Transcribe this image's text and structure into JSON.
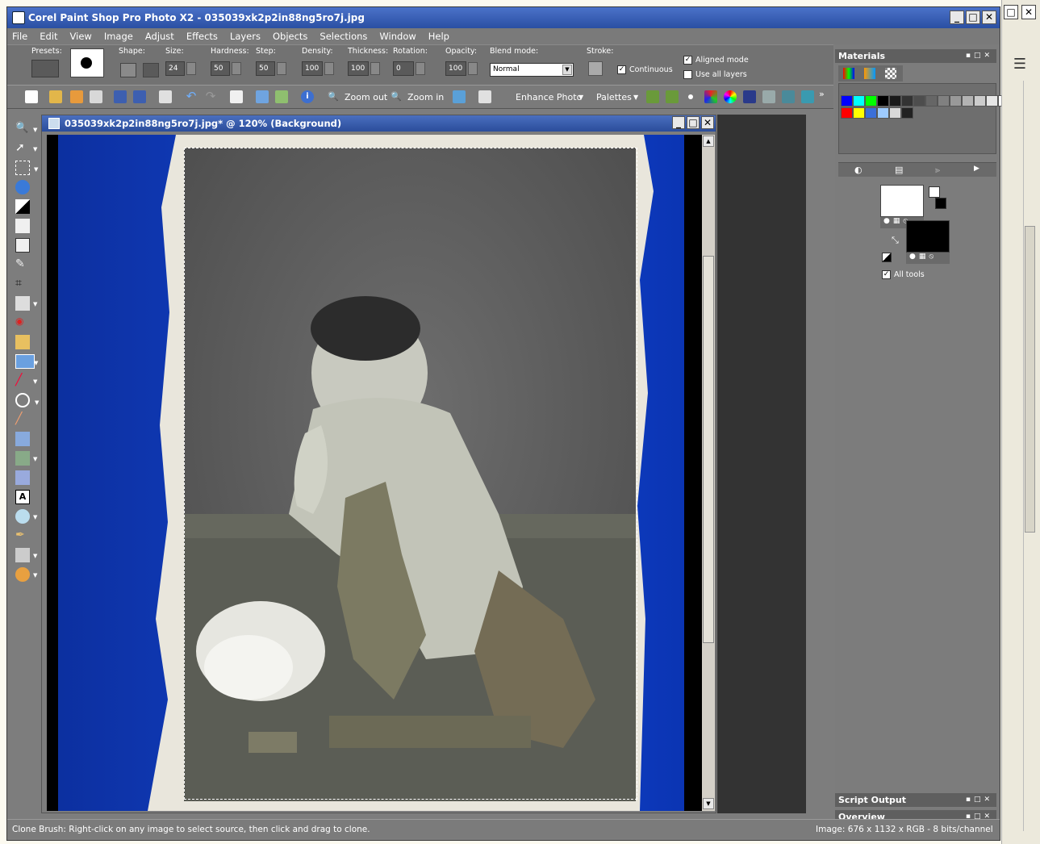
{
  "app": {
    "title": "Corel Paint Shop Pro Photo X2 - 035039xk2p2in88ng5ro7j.jpg"
  },
  "menu": [
    "File",
    "Edit",
    "View",
    "Image",
    "Adjust",
    "Effects",
    "Layers",
    "Objects",
    "Selections",
    "Window",
    "Help"
  ],
  "tool_options": {
    "presets_label": "Presets:",
    "shape_label": "Shape:",
    "size_label": "Size:",
    "size_value": "24",
    "hardness_label": "Hardness:",
    "hardness_value": "50",
    "step_label": "Step:",
    "step_value": "50",
    "density_label": "Density:",
    "density_value": "100",
    "thickness_label": "Thickness:",
    "thickness_value": "100",
    "rotation_label": "Rotation:",
    "rotation_value": "0",
    "opacity_label": "Opacity:",
    "opacity_value": "100",
    "blend_label": "Blend mode:",
    "blend_value": "Normal",
    "stroke_label": "Stroke:",
    "continuous_label": "Continuous",
    "continuous_checked": true,
    "aligned_label": "Aligned mode",
    "aligned_checked": true,
    "use_all_layers_label": "Use all layers",
    "use_all_layers_checked": false
  },
  "toolbar": {
    "zoom_out": "Zoom out",
    "zoom_in": "Zoom in",
    "enhance_photo": "Enhance Photo",
    "palettes": "Palettes"
  },
  "document": {
    "title": "035039xk2p2in88ng5ro7j.jpg* @ 120% (Background)"
  },
  "panels": {
    "materials": "Materials",
    "all_tools": "All tools",
    "all_tools_checked": true,
    "script_output": "Script Output",
    "overview": "Overview"
  },
  "status": {
    "hint": "Clone Brush: Right-click on any image to select source, then click and drag to clone.",
    "image_info": "Image:  676 x 1132 x RGB - 8 bits/channel"
  },
  "colors": {
    "title_gradient": "#2a4fa3",
    "canvas_blue": "#0a35b8",
    "panel_gray": "#7c7c7c"
  },
  "swatches_row1": [
    "#0000ff",
    "#00ffff",
    "#00ff00",
    "#000000",
    "#1a1a1a",
    "#333333",
    "#4d4d4d",
    "#666666",
    "#808080",
    "#999999",
    "#b3b3b3",
    "#cccccc",
    "#e6e6e6",
    "#ffffff",
    "#ff00ff"
  ],
  "swatches_row2": [
    "#ff0000",
    "#ffff00",
    "#3a6fd8",
    "#9ecbff",
    "#d9d9d9",
    "#222222"
  ]
}
